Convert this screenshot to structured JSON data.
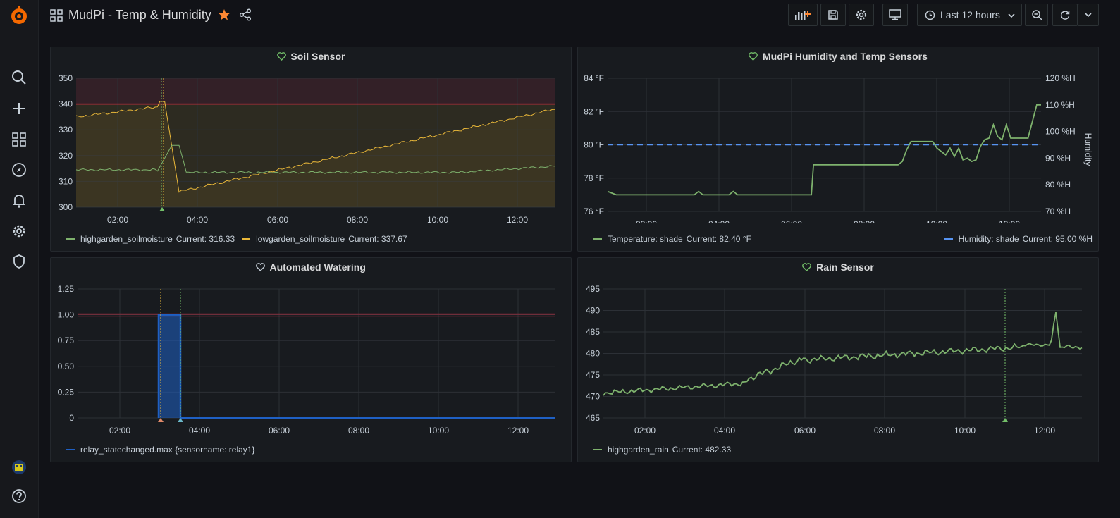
{
  "header": {
    "title": "MudPi - Temp & Humidity",
    "time_range": "Last 12 hours"
  },
  "panels": {
    "soil": {
      "title": "Soil Sensor",
      "y_ticks": [
        "350",
        "340",
        "330",
        "320",
        "310",
        "300"
      ],
      "x_ticks": [
        "02:00",
        "04:00",
        "06:00",
        "08:00",
        "10:00",
        "12:00"
      ],
      "legend": [
        {
          "name": "highgarden_soilmoisture",
          "current": "Current: 316.33",
          "color": "#7eb26d"
        },
        {
          "name": "lowgarden_soilmoisture",
          "current": "Current: 337.67",
          "color": "#eab839"
        }
      ]
    },
    "humidity": {
      "title": "MudPi Humidity and Temp Sensors",
      "y_ticks": [
        "84 °F",
        "82 °F",
        "80 °F",
        "78 °F",
        "76 °F"
      ],
      "y2_ticks": [
        "120 %H",
        "110 %H",
        "100 %H",
        "90 %H",
        "80 %H",
        "70 %H"
      ],
      "y2_label": "Humidity",
      "x_ticks": [
        "02:00",
        "04:00",
        "06:00",
        "08:00",
        "10:00",
        "12:00"
      ],
      "legend": [
        {
          "name": "Temperature: shade",
          "current": "Current: 82.40 °F",
          "color": "#7eb26d"
        },
        {
          "name": "Humidity: shade",
          "current": "Current: 95.00 %H",
          "color": "#5794f2"
        }
      ]
    },
    "watering": {
      "title": "Automated Watering",
      "y_ticks": [
        "1.25",
        "1.00",
        "0.75",
        "0.50",
        "0.25",
        "0"
      ],
      "x_ticks": [
        "02:00",
        "04:00",
        "06:00",
        "08:00",
        "10:00",
        "12:00"
      ],
      "legend": [
        {
          "name": "relay_statechanged.max {sensorname: relay1}",
          "current": "",
          "color": "#1f60c4"
        }
      ]
    },
    "rain": {
      "title": "Rain Sensor",
      "y_ticks": [
        "495",
        "490",
        "485",
        "480",
        "475",
        "470",
        "465"
      ],
      "x_ticks": [
        "02:00",
        "04:00",
        "06:00",
        "08:00",
        "10:00",
        "12:00"
      ],
      "legend": [
        {
          "name": "highgarden_rain",
          "current": "Current: 482.33",
          "color": "#7eb26d"
        }
      ]
    }
  },
  "chart_data": [
    {
      "type": "line",
      "title": "Soil Sensor",
      "ylim": [
        300,
        350
      ],
      "x": [
        "01:00",
        "02:00",
        "03:00",
        "03:10",
        "03:30",
        "04:00",
        "05:00",
        "06:00",
        "07:00",
        "08:00",
        "09:00",
        "10:00",
        "11:00",
        "12:00",
        "12:55"
      ],
      "series": [
        {
          "name": "highgarden_soilmoisture",
          "values": [
            315,
            314,
            314,
            323,
            314,
            313,
            313,
            313,
            313,
            313,
            313,
            314,
            314,
            314,
            316
          ]
        },
        {
          "name": "lowgarden_soilmoisture",
          "values": [
            335,
            337,
            338,
            341,
            306,
            310,
            315,
            319,
            322,
            325,
            328,
            331,
            334,
            336,
            338
          ]
        }
      ],
      "threshold": 340
    },
    {
      "type": "line",
      "title": "MudPi Humidity and Temp Sensors",
      "ylim": [
        76,
        84
      ],
      "y2lim": [
        70,
        120
      ],
      "series": [
        {
          "name": "Temperature: shade",
          "values": [
            77,
            77,
            77,
            77,
            77,
            78.8,
            78.8,
            78.8,
            81,
            80,
            79,
            81,
            81,
            82.4,
            82.4
          ]
        },
        {
          "name": "Humidity: shade",
          "values": [
            95,
            95,
            95,
            95,
            95,
            95,
            95,
            95,
            95,
            95,
            95,
            95,
            95,
            95,
            95
          ]
        }
      ]
    },
    {
      "type": "bar",
      "title": "Automated Watering",
      "ylim": [
        0,
        1.25
      ],
      "series": [
        {
          "name": "relay_statechanged.max {sensorname: relay1}",
          "values": [
            0,
            0,
            1,
            0,
            0,
            0,
            0,
            0,
            0,
            0
          ]
        }
      ],
      "threshold": 1.0
    },
    {
      "type": "line",
      "title": "Rain Sensor",
      "ylim": [
        465,
        495
      ],
      "series": [
        {
          "name": "highgarden_rain",
          "values": [
            471,
            471,
            472,
            473,
            473,
            476,
            478,
            479,
            480,
            480,
            481,
            481,
            482,
            490,
            482
          ]
        }
      ]
    }
  ]
}
